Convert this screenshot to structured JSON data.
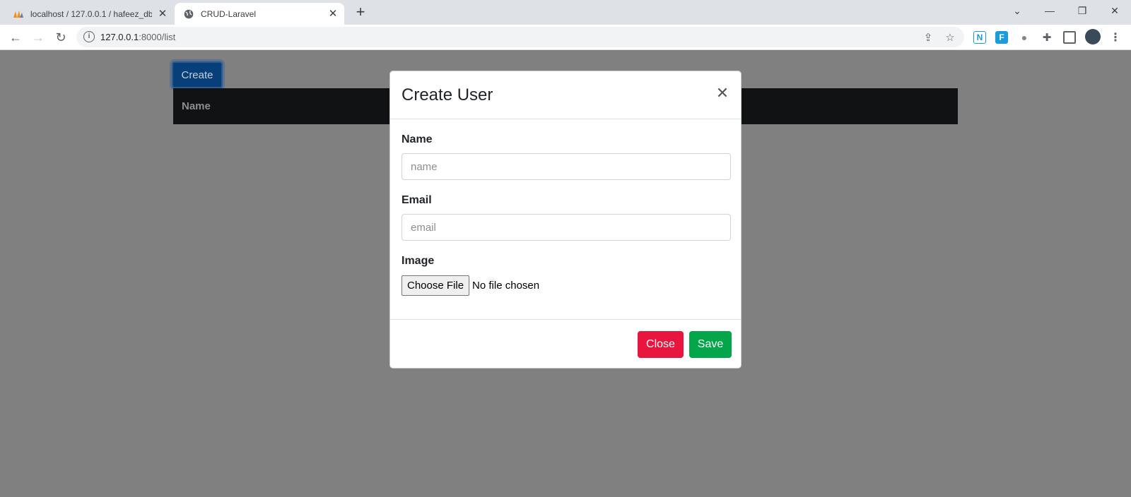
{
  "browser": {
    "tabs": [
      {
        "title": "localhost / 127.0.0.1 / hafeez_db |",
        "icon": "phpmyadmin-icon",
        "active": false
      },
      {
        "title": "CRUD-Laravel",
        "icon": "globe-icon",
        "active": true
      }
    ],
    "url_host": "127.0.0.1",
    "url_port_path": ":8000/list"
  },
  "page": {
    "create_label": "Create",
    "table_headers": [
      "Name"
    ]
  },
  "modal": {
    "title": "Create User",
    "name_label": "Name",
    "name_placeholder": "name",
    "email_label": "Email",
    "email_placeholder": "email",
    "image_label": "Image",
    "file_button": "Choose File",
    "file_status": "No file chosen",
    "close_label": "Close",
    "save_label": "Save"
  },
  "colors": {
    "create_button": "#063f7a",
    "close_button": "#e8163e",
    "save_button": "#03a64a",
    "backdrop": "#808080"
  }
}
